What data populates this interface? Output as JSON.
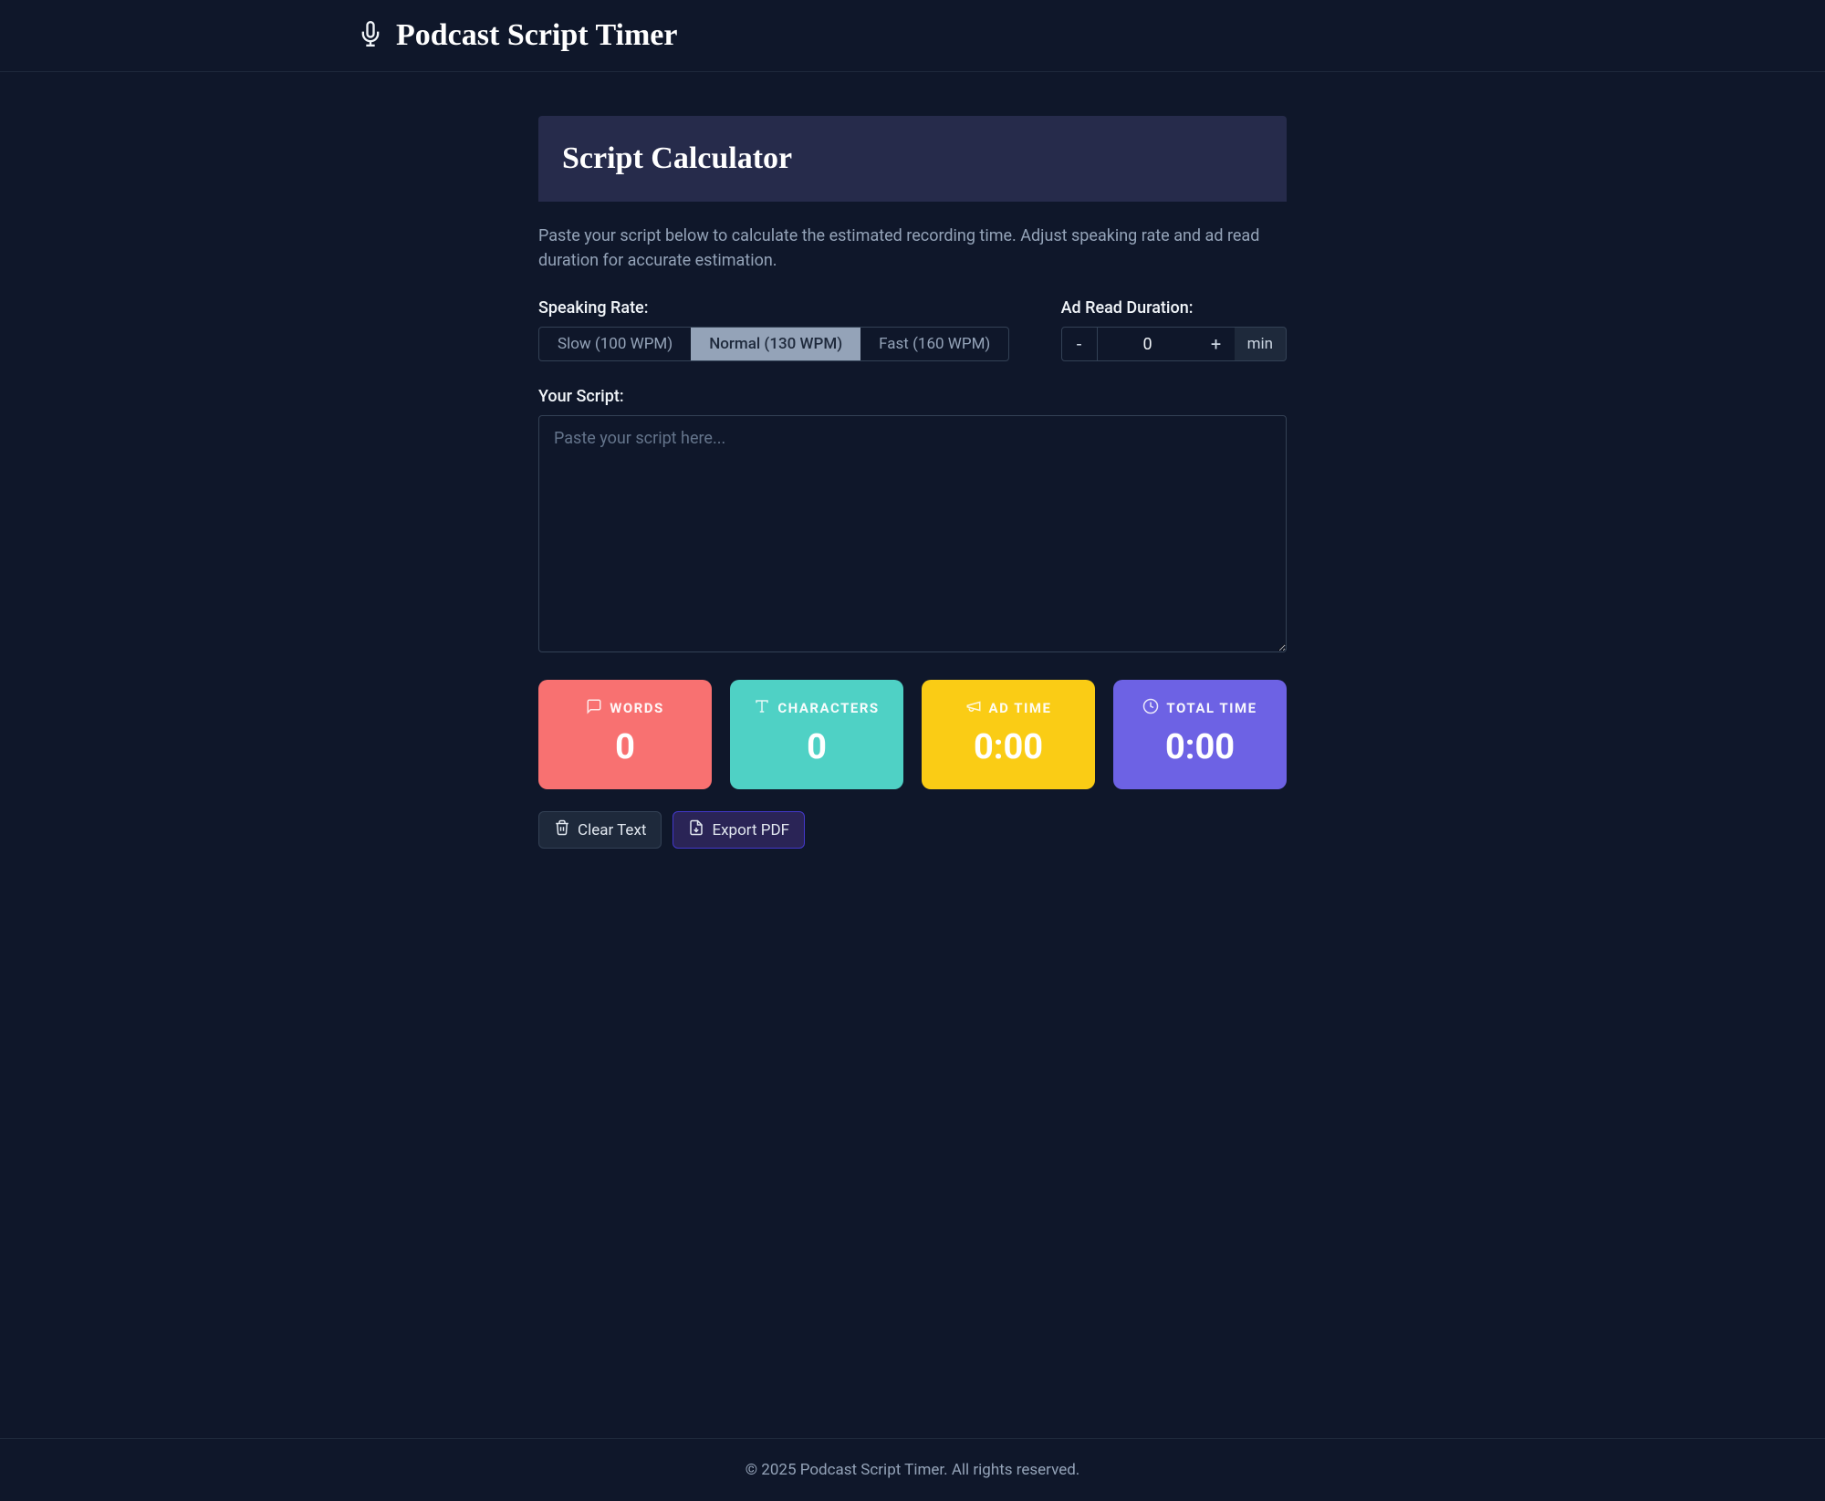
{
  "header": {
    "title": "Podcast Script Timer"
  },
  "card": {
    "title": "Script Calculator",
    "description": "Paste your script below to calculate the estimated recording time. Adjust speaking rate and ad read duration for accurate estimation."
  },
  "speaking_rate": {
    "label": "Speaking Rate:",
    "options": [
      {
        "label": "Slow (100 WPM)",
        "active": false
      },
      {
        "label": "Normal (130 WPM)",
        "active": true
      },
      {
        "label": "Fast (160 WPM)",
        "active": false
      }
    ]
  },
  "ad_duration": {
    "label": "Ad Read Duration:",
    "decrement": "-",
    "value": "0",
    "increment": "+",
    "unit": "min"
  },
  "script": {
    "label": "Your Script:",
    "placeholder": "Paste your script here...",
    "value": ""
  },
  "stats": {
    "words": {
      "label": "WORDS",
      "value": "0"
    },
    "chars": {
      "label": "CHARACTERS",
      "value": "0"
    },
    "adtime": {
      "label": "AD TIME",
      "value": "0:00"
    },
    "total": {
      "label": "TOTAL TIME",
      "value": "0:00"
    }
  },
  "actions": {
    "clear": "Clear Text",
    "export": "Export PDF"
  },
  "footer": {
    "text": "© 2025 Podcast Script Timer. All rights reserved."
  }
}
